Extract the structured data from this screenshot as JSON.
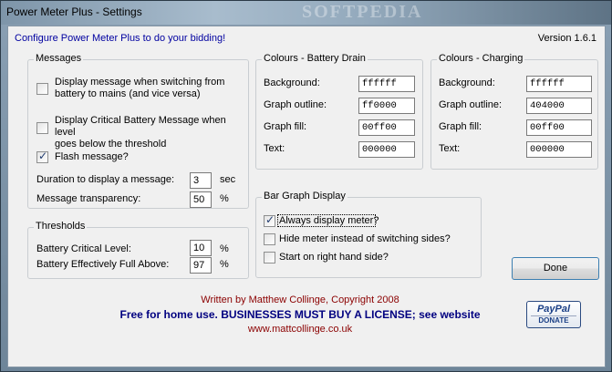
{
  "window": {
    "title": "Power Meter Plus - Settings",
    "watermark": "SOFTPEDIA"
  },
  "header": {
    "headline": "Configure Power Meter Plus to do your bidding!",
    "version": "Version 1.6.1"
  },
  "messages": {
    "title": "Messages",
    "switch_msg": {
      "label_line1": "Display message when switching from",
      "label_line2": "battery to mains (and vice versa)",
      "checked": false
    },
    "critical_msg": {
      "label_line1": "Display Critical Battery Message when level",
      "label_line2": "goes below the threshold",
      "checked": false
    },
    "flash_msg": {
      "label": "Flash message?",
      "checked": true
    },
    "duration": {
      "label": "Duration to display a message:",
      "value": "3",
      "unit": "sec"
    },
    "transparency": {
      "label": "Message transparency:",
      "value": "50",
      "unit": "%"
    }
  },
  "thresholds": {
    "title": "Thresholds",
    "critical": {
      "label": "Battery Critical Level:",
      "value": "10",
      "unit": "%"
    },
    "full": {
      "label": "Battery Effectively Full Above:",
      "value": "97",
      "unit": "%"
    }
  },
  "colours_drain": {
    "title": "Colours - Battery Drain",
    "rows": [
      {
        "label": "Background:",
        "value": "ffffff"
      },
      {
        "label": "Graph outline:",
        "value": "ff0000"
      },
      {
        "label": "Graph fill:",
        "value": "00ff00"
      },
      {
        "label": "Text:",
        "value": "000000"
      }
    ]
  },
  "colours_charging": {
    "title": "Colours - Charging",
    "rows": [
      {
        "label": "Background:",
        "value": "ffffff"
      },
      {
        "label": "Graph outline:",
        "value": "404000"
      },
      {
        "label": "Graph fill:",
        "value": "00ff00"
      },
      {
        "label": "Text:",
        "value": "000000"
      }
    ]
  },
  "bar_graph": {
    "title": "Bar Graph Display",
    "always_display": {
      "label": "Always display meter?",
      "checked": true
    },
    "hide_meter": {
      "label": "Hide meter instead of switching sides?",
      "checked": false
    },
    "start_right": {
      "label": "Start on right hand side?",
      "checked": false
    }
  },
  "done_label": "Done",
  "credits": {
    "author": "Written by Matthew Collinge, Copyright 2008",
    "license": "Free for home use. BUSINESSES MUST BUY A LICENSE; see website",
    "website": "www.mattcollinge.co.uk"
  },
  "paypal": {
    "brand": "PayPal",
    "action": "DONATE"
  },
  "colors": {
    "headline": "#0000a0",
    "credits_author": "#8b0000",
    "credits_license": "#000080",
    "website": "#8b0000"
  }
}
